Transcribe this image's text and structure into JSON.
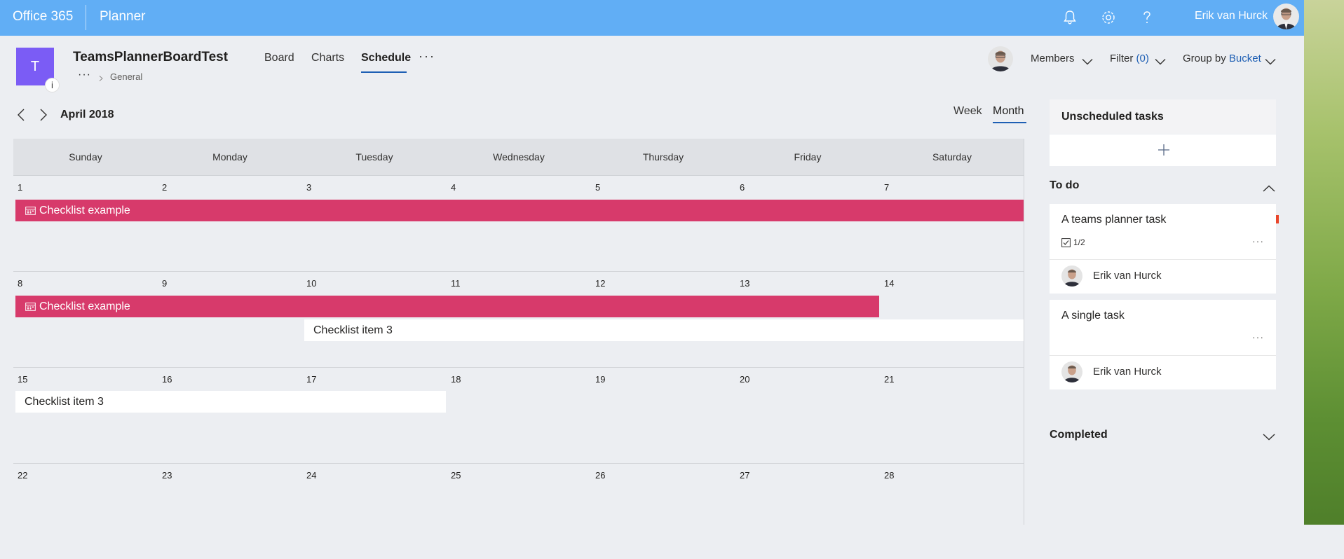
{
  "topbar": {
    "brand": "Office 365",
    "app": "Planner",
    "icons": [
      "bell-icon",
      "gear-icon",
      "help-icon"
    ],
    "user_name": "Erik van Hurck",
    "color": "#61aef5"
  },
  "plan": {
    "tile_letter": "T",
    "info_badge": "i",
    "title": "TeamsPlannerBoardTest",
    "more_dots": "···",
    "channel": "General",
    "tile_color": "#7b5cf5"
  },
  "nav": {
    "tabs": [
      "Board",
      "Charts",
      "Schedule"
    ],
    "active": "Schedule",
    "more": "···"
  },
  "header_controls": {
    "members": "Members",
    "filter_label": "Filter",
    "filter_count": "(0)",
    "group_by_label": "Group by",
    "group_by_value": "Bucket"
  },
  "schedule": {
    "month": "April 2018",
    "views": [
      "Week",
      "Month"
    ],
    "active_view": "Month"
  },
  "calendar": {
    "days": [
      "Sunday",
      "Monday",
      "Tuesday",
      "Wednesday",
      "Thursday",
      "Friday",
      "Saturday"
    ],
    "weeks": [
      [
        "1",
        "2",
        "3",
        "4",
        "5",
        "6",
        "7"
      ],
      [
        "8",
        "9",
        "10",
        "11",
        "12",
        "13",
        "14"
      ],
      [
        "15",
        "16",
        "17",
        "18",
        "19",
        "20",
        "21"
      ],
      [
        "22",
        "23",
        "24",
        "25",
        "26",
        "27",
        "28"
      ]
    ],
    "events": {
      "w1_checklist": "Checklist example",
      "w2_checklist": "Checklist example",
      "w2_item": "Checklist item 3",
      "w3_item": "Checklist item 3"
    },
    "event_color": "#d73a6b"
  },
  "panel": {
    "unscheduled_title": "Unscheduled tasks",
    "todo_title": "To do",
    "completed_title": "Completed",
    "tasks": [
      {
        "title": "A teams planner task",
        "checklist": "1/2",
        "assignee": "Erik van Hurck",
        "more": "···"
      },
      {
        "title": "A single task",
        "assignee": "Erik van Hurck",
        "more": "···"
      }
    ]
  }
}
